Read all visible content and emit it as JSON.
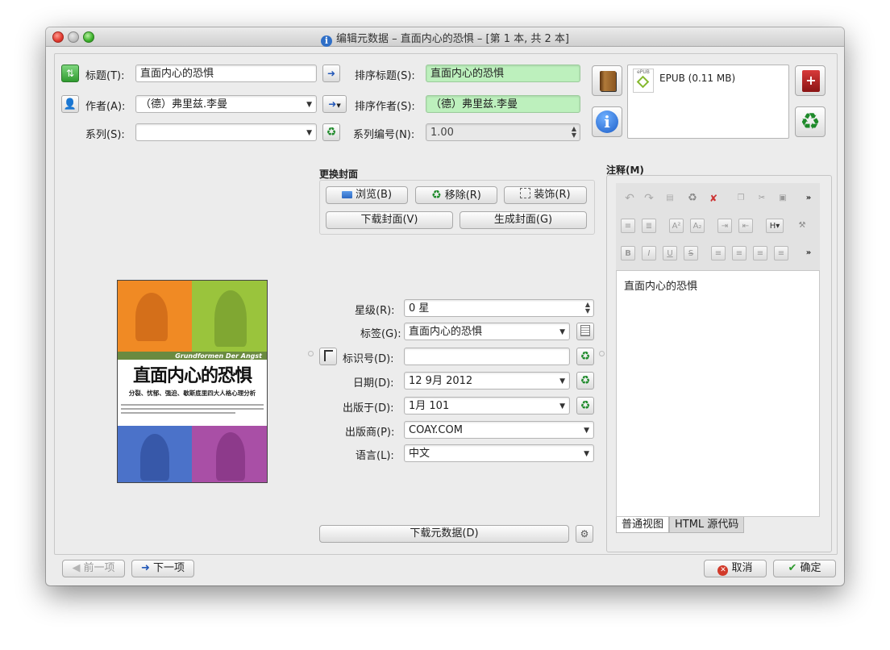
{
  "window": {
    "title": "编辑元数据 – 直面内心的恐惧 – [第 1 本, 共 2 本]"
  },
  "fields": {
    "title_label": "标题(T):",
    "title_value": "直面内心的恐惧",
    "sort_title_label": "排序标题(S):",
    "sort_title_value": "直面内心的恐惧",
    "author_label": "作者(A):",
    "author_value": "（德）弗里兹.李曼",
    "sort_author_label": "排序作者(S):",
    "sort_author_value": "（德）弗里兹.李曼",
    "series_label": "系列(S):",
    "series_value": "",
    "series_index_label": "系列编号(N):",
    "series_index_value": "1.00"
  },
  "formats": {
    "items": [
      {
        "name": "EPUB (0.11 MB)",
        "icon": "epub-icon"
      }
    ]
  },
  "cover": {
    "section_label": "更换封面",
    "browse_label": "浏览(B)",
    "remove_label": "移除(R)",
    "trim_label": "装饰(R)",
    "download_label": "下载封面(V)",
    "generate_label": "生成封面(G)",
    "image": {
      "text_top": "Grundformen Der Angst",
      "title": "直面内心的恐惧",
      "subtitle": "分裂、忧郁、强迫、歇斯底里四大人格心理分析",
      "colors": {
        "orange": "#f08a24",
        "green": "#9ac43c",
        "blue": "#4b72c9",
        "purple": "#a94fa6"
      }
    }
  },
  "metadata": {
    "rating_label": "星级(R):",
    "rating_value": "0 星",
    "tags_label": "标签(G):",
    "tags_value": "直面内心的恐惧",
    "ids_label": "标识号(D):",
    "ids_value": "",
    "date_label": "日期(D):",
    "date_value": "12 9月 2012",
    "pubdate_label": "出版于(D):",
    "pubdate_value": "1月 101",
    "publisher_label": "出版商(P):",
    "publisher_value": "COAY.COM",
    "language_label": "语言(L):",
    "language_value": "中文",
    "download_metadata_label": "下载元数据(D)"
  },
  "comments": {
    "label": "注释(M)",
    "text": "直面内心的恐惧",
    "tab_normal": "普通视图",
    "tab_html": "HTML 源代码"
  },
  "footer": {
    "prev_label": "前一项",
    "next_label": "下一项",
    "cancel_label": "取消",
    "ok_label": "确定"
  }
}
